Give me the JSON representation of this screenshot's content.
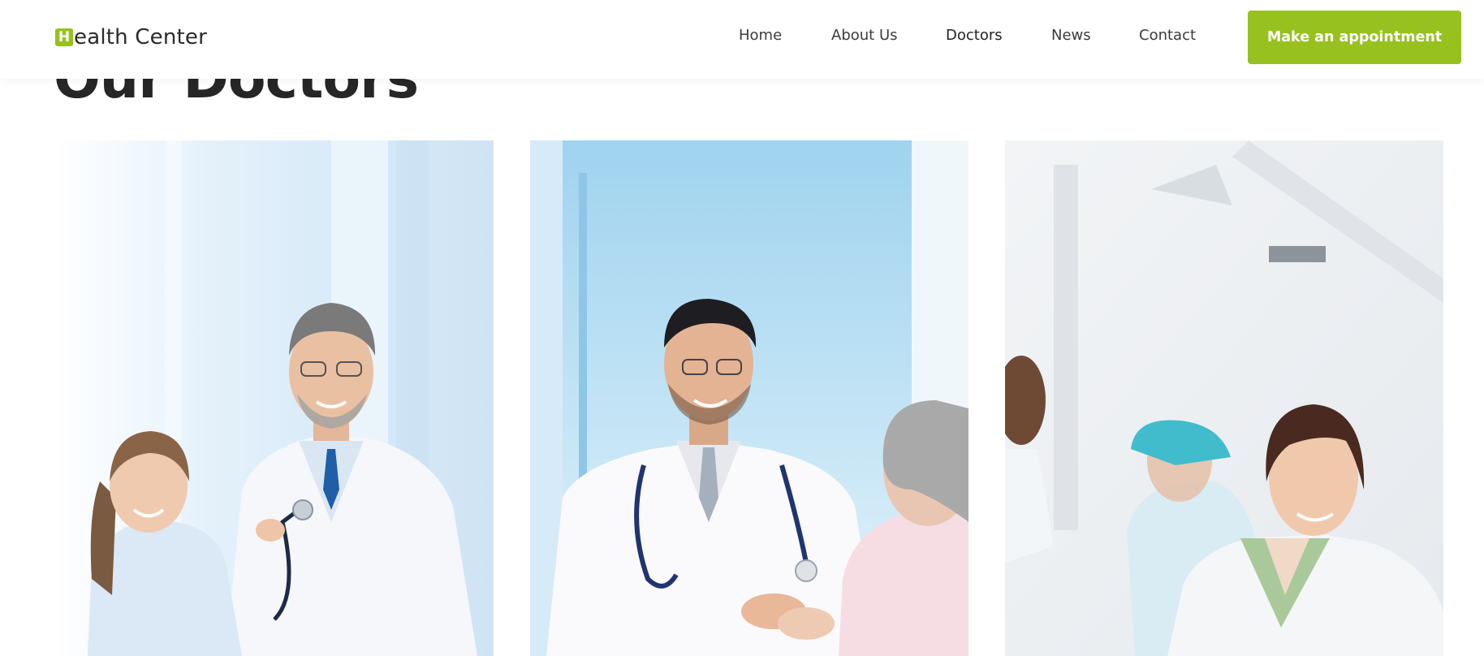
{
  "header": {
    "logo_letter": "H",
    "logo_text": "ealth Center",
    "nav": [
      {
        "label": "Home"
      },
      {
        "label": "About Us"
      },
      {
        "label": "Doctors"
      },
      {
        "label": "News"
      },
      {
        "label": "Contact"
      }
    ],
    "cta_label": "Make an appointment"
  },
  "section": {
    "title": "Our Doctors"
  },
  "colors": {
    "accent": "#97c11f",
    "text": "#262626"
  }
}
